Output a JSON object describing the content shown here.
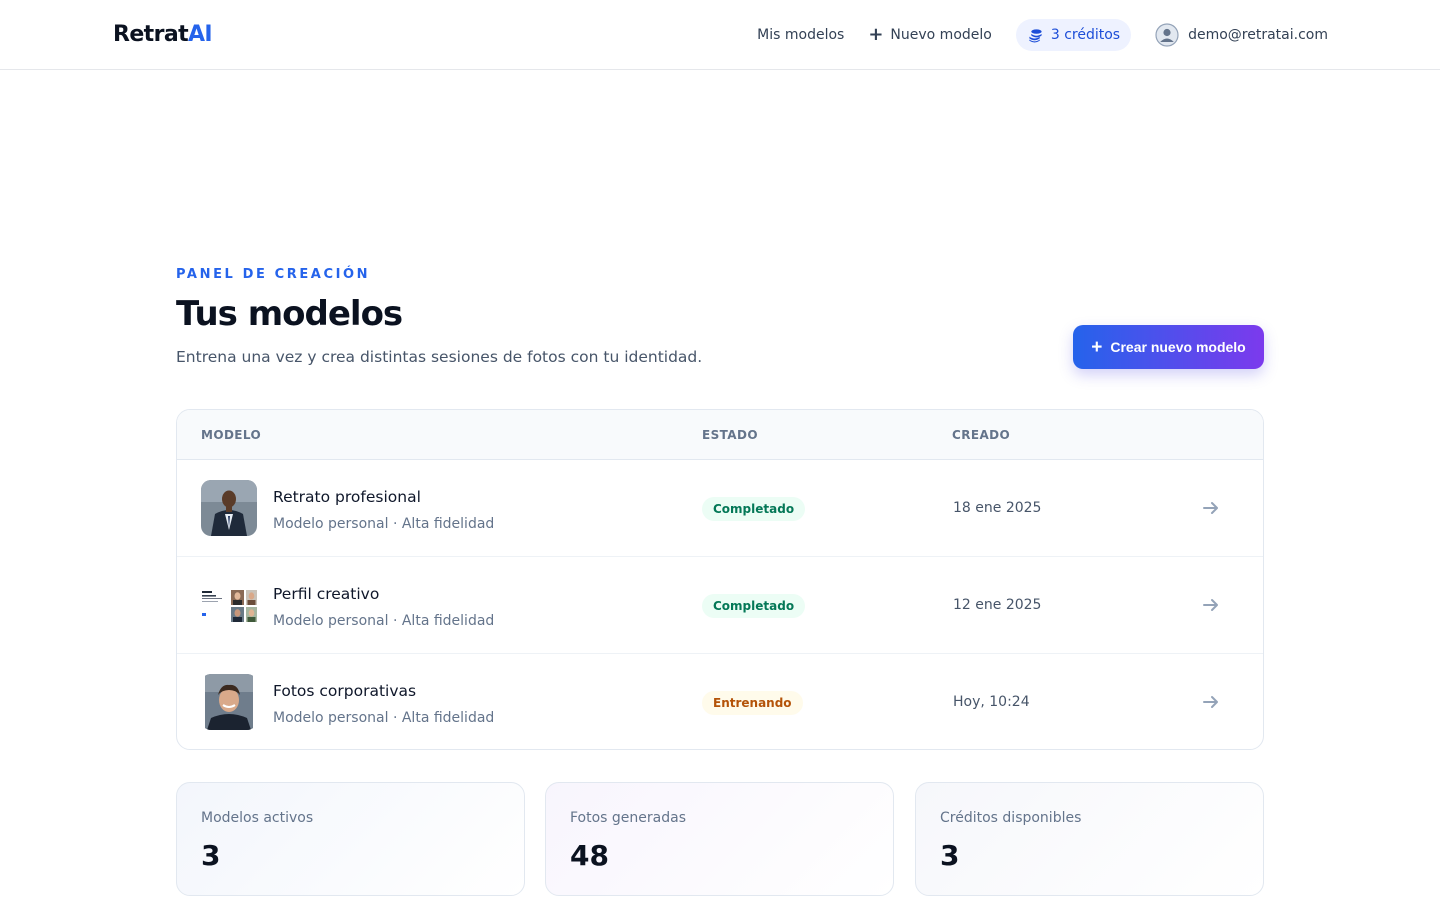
{
  "header": {
    "logo_main": "Retrat",
    "logo_accent": "AI",
    "nav": {
      "mis_modelos": "Mis modelos",
      "nuevo_modelo": "Nuevo modelo",
      "credits": "3 créditos",
      "user_email": "demo@retratai.com"
    }
  },
  "page": {
    "eyebrow": "PANEL DE CREACIÓN",
    "title": "Tus modelos",
    "subtitle": "Entrena una vez y crea distintas sesiones de fotos con tu identidad.",
    "create_button": "Crear nuevo modelo"
  },
  "table": {
    "headers": [
      "MODELO",
      "ESTADO",
      "CREADO"
    ],
    "rows": [
      {
        "name": "Retrato profesional",
        "meta": "Modelo personal · Alta fidelidad",
        "status": "Completado",
        "created": "18 ene 2025"
      },
      {
        "name": "Perfil creativo",
        "meta": "Modelo personal · Alta fidelidad",
        "status": "Completado",
        "created": "12 ene 2025"
      },
      {
        "name": "Fotos corporativas",
        "meta": "Modelo personal · Alta fidelidad",
        "status": "Entrenando",
        "created": "Hoy, 10:24"
      }
    ]
  },
  "stats": [
    {
      "label": "Modelos activos",
      "value": "3"
    },
    {
      "label": "Fotos generadas",
      "value": "48"
    },
    {
      "label": "Créditos disponibles",
      "value": "3"
    }
  ],
  "colors": {
    "accent": "#2563eb",
    "gradient_end": "#7c3aed",
    "status_done": "#047857",
    "status_training": "#b45309"
  }
}
